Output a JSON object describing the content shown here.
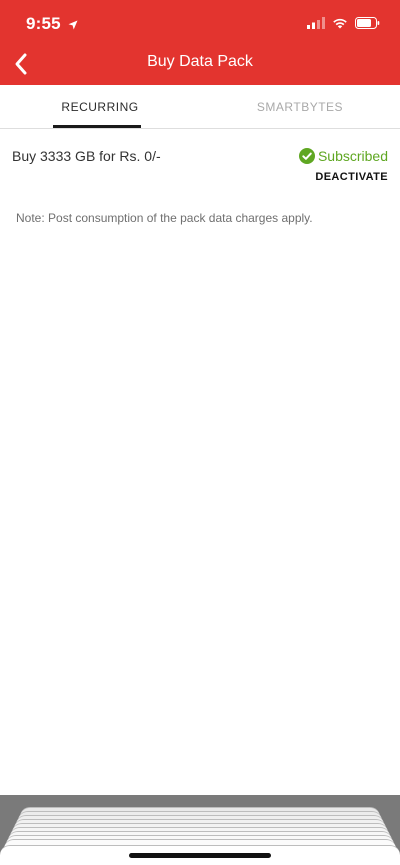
{
  "status_bar": {
    "time": "9:55"
  },
  "header": {
    "title": "Buy Data Pack"
  },
  "tabs": [
    {
      "label": "RECURRING",
      "active": true
    },
    {
      "label": "SMARTBYTES",
      "active": false
    }
  ],
  "pack": {
    "description": "Buy 3333 GB for Rs. 0/-",
    "status": "Subscribed",
    "action": "DEACTIVATE"
  },
  "note": "Note: Post consumption of the pack data charges apply.",
  "colors": {
    "brand": "#e3342f",
    "success": "#5fa722"
  },
  "icons": {
    "back": "chevron-left-icon",
    "status": "check-circle-icon",
    "location": "location-arrow-icon",
    "signal": "signal-icon",
    "wifi": "wifi-icon",
    "battery": "battery-icon"
  }
}
